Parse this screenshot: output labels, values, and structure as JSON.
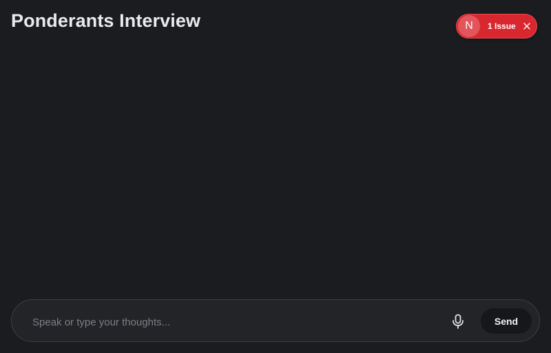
{
  "header": {
    "title": "Ponderants Interview"
  },
  "issue_badge": {
    "avatar_letter": "N",
    "label": "1 Issue",
    "color": "#d9272f"
  },
  "composer": {
    "placeholder": "Speak or type your thoughts...",
    "value": "",
    "mic_icon": "microphone-icon",
    "send_label": "Send"
  }
}
